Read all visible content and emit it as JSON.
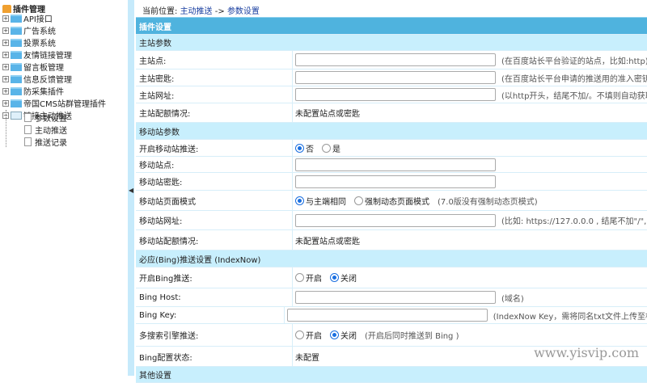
{
  "sidebar": {
    "root": "插件管理",
    "items": [
      {
        "label": "API接口"
      },
      {
        "label": "广告系统"
      },
      {
        "label": "投票系统"
      },
      {
        "label": "友情链接管理"
      },
      {
        "label": "留言板管理"
      },
      {
        "label": "信息反馈管理"
      },
      {
        "label": "防采集插件"
      },
      {
        "label": "帝国CMS站群管理插件"
      },
      {
        "label": "链接主动推送",
        "expanded": true
      }
    ],
    "children": [
      {
        "label": "参数设置"
      },
      {
        "label": "主动推送"
      },
      {
        "label": "推送记录"
      }
    ]
  },
  "breadcrumb": {
    "prefix": "当前位置:",
    "link1": "主动推送",
    "sep": "->",
    "link2": "参数设置"
  },
  "table": {
    "title": "插件设置",
    "rows": [
      {
        "type": "section",
        "label": "主站参数"
      },
      {
        "type": "input",
        "label": "主站点:",
        "value": "",
        "note": "(在百度站长平台验证的站点，比如:http)"
      },
      {
        "type": "input",
        "label": "主站密匙:",
        "value": "",
        "note": "(在百度站长平台申请的推送用的准入密钥)"
      },
      {
        "type": "input",
        "label": "主站网址:",
        "value": "",
        "note": "(以http开头，结尾不加/。不填则自动获取"
      },
      {
        "type": "static",
        "label": "主站配额情况:",
        "value": "未配置站点或密匙"
      },
      {
        "type": "section",
        "label": "移动站参数"
      },
      {
        "type": "radio",
        "label": "开启移动站推送:",
        "options": [
          {
            "label": "否",
            "checked": true
          },
          {
            "label": "是",
            "checked": false
          }
        ]
      },
      {
        "type": "input",
        "label": "移动站点:",
        "value": ""
      },
      {
        "type": "input",
        "label": "移动站密匙:",
        "value": ""
      },
      {
        "type": "radio",
        "label": "移动站页面模式",
        "options": [
          {
            "label": "与主端相同",
            "checked": true
          },
          {
            "label": "强制动态页面模式",
            "checked": false
          }
        ],
        "note": "(7.0版没有强制动态页模式)"
      },
      {
        "type": "input",
        "label": "移动站网址:",
        "value": "",
        "note": "(比如: https://127.0.0.0 , 结尾不加\"/\", )"
      },
      {
        "type": "static",
        "label": "移动站配额情况:",
        "value": "未配置站点或密匙"
      },
      {
        "type": "section",
        "label": "必应(Bing)推送设置 (IndexNow)"
      },
      {
        "type": "radio",
        "label": "开启Bing推送:",
        "options": [
          {
            "label": "开启",
            "checked": false
          },
          {
            "label": "关闭",
            "checked": true
          }
        ]
      },
      {
        "type": "input",
        "label": "Bing Host:",
        "value": "",
        "note": "(域名)"
      },
      {
        "type": "input",
        "label": "Bing Key:",
        "value": "",
        "note": "(IndexNow Key，需将同名txt文件上传至根"
      },
      {
        "type": "radio",
        "label": "多搜索引擎推送:",
        "options": [
          {
            "label": "开启",
            "checked": false
          },
          {
            "label": "关闭",
            "checked": true
          }
        ],
        "note": "(开启后同时推送到 Bing )"
      },
      {
        "type": "static",
        "label": "Bing配置状态:",
        "value": "未配置"
      },
      {
        "type": "section",
        "label": "其他设置"
      }
    ]
  },
  "watermark": "www.yisvip.com",
  "colors": {
    "header": "#4fb3de",
    "section": "#c8effd",
    "link": "#1a3fa0"
  }
}
